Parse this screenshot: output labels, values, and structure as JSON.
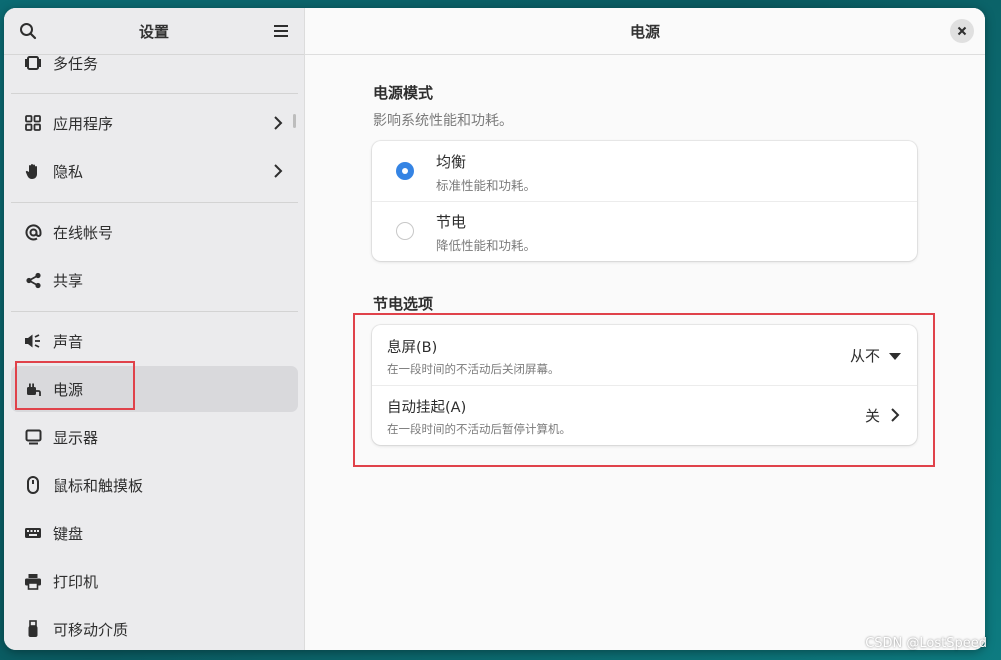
{
  "sidebar": {
    "title": "设置",
    "items": [
      {
        "label": "多任务",
        "icon": "multitasking-icon"
      },
      {
        "label": "应用程序",
        "icon": "apps-grid-icon"
      },
      {
        "label": "隐私",
        "icon": "hand-privacy-icon"
      },
      {
        "label": "在线帐号",
        "icon": "at-sign-icon"
      },
      {
        "label": "共享",
        "icon": "share-icon"
      },
      {
        "label": "声音",
        "icon": "speaker-icon"
      },
      {
        "label": "电源",
        "icon": "power-plug-icon"
      },
      {
        "label": "显示器",
        "icon": "display-icon"
      },
      {
        "label": "鼠标和触摸板",
        "icon": "mouse-icon"
      },
      {
        "label": "键盘",
        "icon": "keyboard-icon"
      },
      {
        "label": "打印机",
        "icon": "printer-icon"
      },
      {
        "label": "可移动介质",
        "icon": "usb-drive-icon"
      }
    ],
    "active_item": "电源"
  },
  "content": {
    "title": "电源",
    "power_mode": {
      "title": "电源模式",
      "subtitle": "影响系统性能和功耗。",
      "options": [
        {
          "title": "均衡",
          "subtitle": "标准性能和功耗。",
          "selected": true
        },
        {
          "title": "节电",
          "subtitle": "降低性能和功耗。",
          "selected": false
        }
      ]
    },
    "power_saving": {
      "title": "节电选项",
      "rows": [
        {
          "title": "息屏(B)",
          "subtitle": "在一段时间的不活动后关闭屏幕。",
          "value": "从不"
        },
        {
          "title": "自动挂起(A)",
          "subtitle": "在一段时间的不活动后暂停计算机。",
          "value": "关"
        }
      ]
    }
  },
  "watermark": "CSDN @LostSpeed",
  "colors": {
    "accent": "#3584e4",
    "highlight": "#e0424a"
  }
}
